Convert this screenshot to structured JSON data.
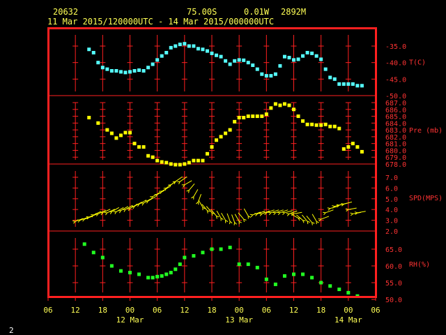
{
  "header": {
    "station": "20632",
    "latitude": "75.00S",
    "longitude": "0.01W",
    "elevation": "2892M",
    "period": "11 Mar 2015/120000UTC - 14 Mar 2015/000000UTC"
  },
  "page_number": "2",
  "colors": {
    "frame": "#ff2020",
    "grid": "#ff2020",
    "label": "#ff3333",
    "text": "#ffff55",
    "temperature": "#55ffff",
    "pressure": "#ffff00",
    "wind": "#ffff00",
    "humidity": "#22ff22"
  },
  "chart_data": {
    "type": "scatter",
    "x_axis": {
      "tick_labels": [
        "06",
        "12",
        "18",
        "00",
        "06",
        "12",
        "18",
        "00",
        "06",
        "12",
        "18",
        "00",
        "06"
      ],
      "tick_hours": [
        -6,
        0,
        6,
        12,
        18,
        24,
        30,
        36,
        42,
        48,
        54,
        60,
        66
      ],
      "date_labels": [
        {
          "label": "12 Mar",
          "hour": 12
        },
        {
          "label": "13 Mar",
          "hour": 36
        },
        {
          "label": "14 Mar",
          "hour": 60
        }
      ],
      "range": [
        -6,
        66
      ]
    },
    "panels": [
      {
        "id": "temperature",
        "label": "T(C)",
        "marker": "square",
        "color": "#55ffff",
        "ylim": [
          -50.0,
          -32.0
        ],
        "yticks": [
          -50.0,
          -45.0,
          -40.0,
          -35.0
        ],
        "tick_labels": [
          "-50.0",
          "-45.0",
          "-40.0",
          "-35.0"
        ],
        "x": [
          3,
          4,
          5,
          6,
          7,
          8,
          9,
          10,
          11,
          12,
          13,
          14,
          15,
          16,
          17,
          18,
          19,
          20,
          21,
          22,
          23,
          24,
          25,
          26,
          27,
          28,
          29,
          30,
          31,
          32,
          33,
          34,
          35,
          36,
          37,
          38,
          39,
          40,
          41,
          42,
          43,
          44,
          45,
          46,
          47,
          48,
          49,
          50,
          51,
          52,
          53,
          54,
          55,
          56,
          57,
          58,
          59,
          60,
          61,
          62,
          63
        ],
        "y": [
          -36.0,
          -37.0,
          -40.0,
          -41.5,
          -42.0,
          -42.5,
          -42.5,
          -42.8,
          -43.0,
          -42.8,
          -42.5,
          -42.3,
          -42.5,
          -41.5,
          -40.5,
          -39.2,
          -38.0,
          -37.0,
          -35.5,
          -35.0,
          -34.5,
          -34.3,
          -35.0,
          -35.0,
          -35.8,
          -36.0,
          -36.5,
          -37.2,
          -37.8,
          -38.2,
          -39.5,
          -40.5,
          -39.5,
          -39.2,
          -39.3,
          -40.0,
          -40.8,
          -42.0,
          -43.5,
          -44.0,
          -44.0,
          -43.5,
          -41.0,
          -38.2,
          -38.5,
          -39.2,
          -39.0,
          -38.0,
          -37.0,
          -37.2,
          -38.0,
          -39.0,
          -42.0,
          -44.5,
          -45.0,
          -46.5,
          -46.5,
          -46.5,
          -46.5,
          -47.0,
          -47.0
        ]
      },
      {
        "id": "pressure",
        "label": "Pre (mb)",
        "marker": "square",
        "color": "#ffff00",
        "ylim": [
          677.5,
          688.0
        ],
        "yticks": [
          678.0,
          679.0,
          680.0,
          681.0,
          682.0,
          683.0,
          684.0,
          685.0,
          686.0,
          687.0
        ],
        "tick_labels": [
          "678.0",
          "679.0",
          "680.0",
          "681.0",
          "682.0",
          "683.0",
          "684.0",
          "685.0",
          "686.0",
          "687.0"
        ],
        "x": [
          3,
          5,
          7,
          8,
          9,
          10,
          11,
          12,
          13,
          14,
          15,
          16,
          17,
          18,
          19,
          20,
          21,
          22,
          23,
          24,
          25,
          26,
          27,
          28,
          29,
          30,
          31,
          32,
          33,
          34,
          35,
          36,
          37,
          38,
          39,
          40,
          41,
          42,
          43,
          44,
          45,
          46,
          47,
          48,
          49,
          50,
          51,
          52,
          53,
          54,
          55,
          56,
          57,
          58,
          59,
          60,
          61,
          62,
          63
        ],
        "y": [
          684.8,
          684.0,
          683.0,
          682.5,
          681.8,
          682.2,
          682.6,
          682.6,
          681.0,
          680.5,
          680.5,
          679.2,
          679.0,
          678.5,
          678.3,
          678.2,
          678.0,
          677.9,
          677.9,
          678.0,
          678.2,
          678.5,
          678.5,
          678.5,
          679.5,
          680.5,
          681.5,
          682.0,
          682.5,
          683.0,
          684.2,
          684.8,
          684.8,
          685.0,
          685.0,
          685.0,
          685.0,
          685.3,
          686.2,
          686.8,
          686.6,
          686.8,
          686.6,
          686.0,
          685.0,
          684.3,
          683.8,
          683.8,
          683.7,
          683.7,
          683.8,
          683.5,
          683.5,
          683.2,
          680.2,
          680.5,
          681.0,
          680.5,
          679.8
        ]
      },
      {
        "id": "wind",
        "label": "SPD(MPS)",
        "marker": "wind-barb",
        "color": "#ffff00",
        "ylim": [
          2.0,
          7.5
        ],
        "yticks": [
          2.0,
          3.0,
          4.0,
          5.0,
          6.0,
          7.0
        ],
        "tick_labels": [
          "2.0",
          "3.0",
          "4.0",
          "5.0",
          "6.0",
          "7.0"
        ],
        "x": [
          0,
          1,
          2,
          3,
          4,
          5,
          6,
          7,
          8,
          9,
          10,
          11,
          12,
          13,
          14,
          15,
          16,
          17,
          18,
          19,
          20,
          21,
          22,
          23,
          24,
          25,
          26,
          27,
          28,
          29,
          30,
          31,
          32,
          33,
          34,
          35,
          36,
          37,
          38,
          39,
          40,
          41,
          42,
          43,
          44,
          45,
          46,
          47,
          48,
          49,
          50,
          51,
          52,
          53,
          54,
          55,
          56,
          57,
          58,
          59,
          60,
          61,
          62
        ],
        "y": [
          2.9,
          3.0,
          3.1,
          3.3,
          3.5,
          3.6,
          3.7,
          3.7,
          3.8,
          3.8,
          3.9,
          4.0,
          4.1,
          4.3,
          4.5,
          4.6,
          4.8,
          5.2,
          5.4,
          5.7,
          6.0,
          6.3,
          6.6,
          6.6,
          6.3,
          5.8,
          5.2,
          4.7,
          4.2,
          3.9,
          3.7,
          3.4,
          3.2,
          3.0,
          2.9,
          2.8,
          2.9,
          3.1,
          3.4,
          3.5,
          3.6,
          3.6,
          3.7,
          3.7,
          3.7,
          3.7,
          3.7,
          3.6,
          3.6,
          3.2,
          3.0,
          2.9,
          2.8,
          2.9,
          3.1,
          3.7,
          4.1,
          4.3,
          4.4,
          4.5,
          4.0,
          3.6,
          3.7
        ],
        "direction_deg": [
          70,
          70,
          70,
          70,
          65,
          65,
          65,
          65,
          60,
          60,
          60,
          60,
          60,
          60,
          60,
          60,
          60,
          60,
          60,
          60,
          55,
          55,
          55,
          55,
          60,
          40,
          30,
          20,
          330,
          320,
          320,
          320,
          330,
          330,
          340,
          340,
          330,
          320,
          330,
          70,
          70,
          70,
          70,
          70,
          70,
          70,
          75,
          70,
          80,
          300,
          310,
          320,
          320,
          330,
          70,
          70,
          75,
          75,
          75,
          75,
          80,
          80,
          80
        ]
      },
      {
        "id": "humidity",
        "label": "RH(%)",
        "marker": "square",
        "color": "#22ff22",
        "ylim": [
          50.0,
          68.5
        ],
        "yticks": [
          50.0,
          55.0,
          60.0,
          65.0
        ],
        "tick_labels": [
          "50.0",
          "55.0",
          "60.0",
          "65.0"
        ],
        "x": [
          2,
          4,
          6,
          8,
          10,
          12,
          14,
          16,
          17,
          18,
          19,
          20,
          21,
          22,
          23,
          24,
          26,
          28,
          30,
          32,
          34,
          36,
          38,
          40,
          42,
          44,
          46,
          48,
          50,
          52,
          54,
          56,
          58,
          60,
          62
        ],
        "y": [
          66.5,
          64.0,
          62.5,
          60.0,
          58.5,
          58.0,
          57.5,
          56.5,
          56.5,
          56.8,
          57.0,
          57.5,
          58.0,
          59.0,
          60.5,
          62.5,
          63.0,
          64.0,
          65.0,
          65.0,
          65.5,
          60.5,
          60.5,
          59.5,
          56.0,
          54.5,
          57.0,
          57.5,
          57.5,
          56.5,
          55.0,
          54.0,
          53.0,
          52.0,
          51.0
        ]
      }
    ]
  }
}
